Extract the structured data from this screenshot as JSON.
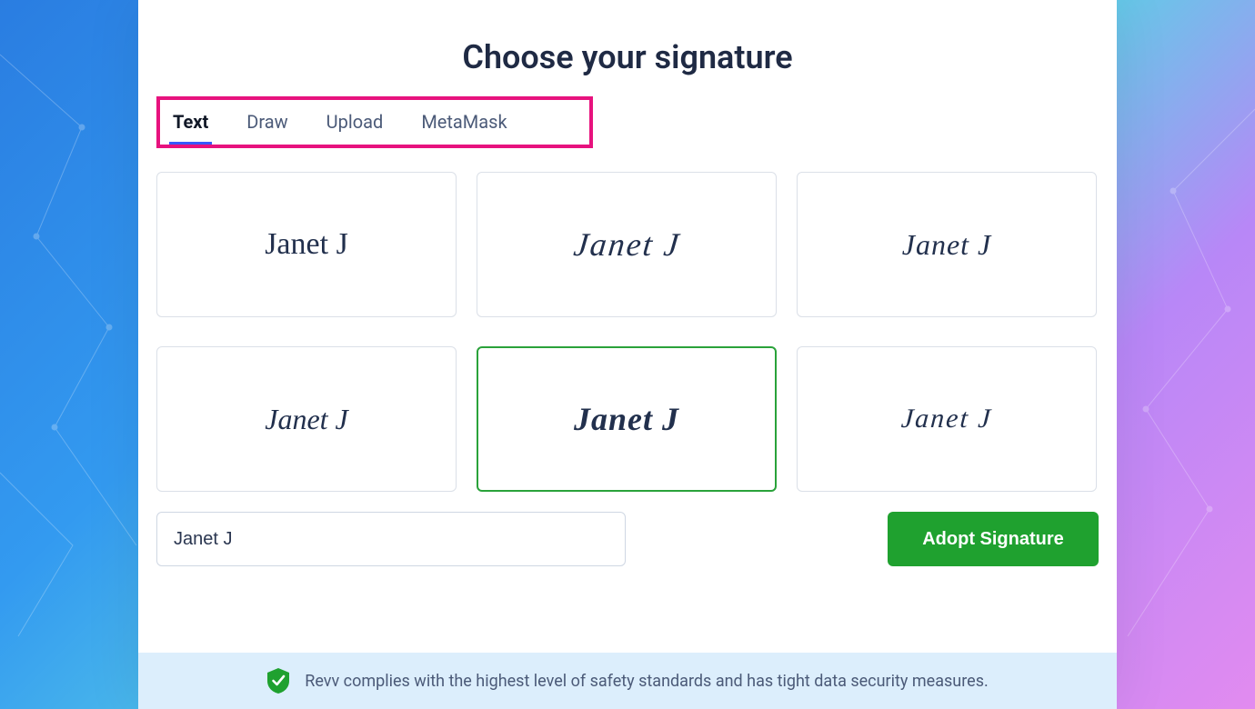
{
  "title": "Choose your signature",
  "tabs": {
    "items": [
      {
        "id": "text",
        "label": "Text",
        "active": true
      },
      {
        "id": "draw",
        "label": "Draw",
        "active": false
      },
      {
        "id": "upload",
        "label": "Upload",
        "active": false
      },
      {
        "id": "metamask",
        "label": "MetaMask",
        "active": false
      }
    ]
  },
  "signatures": [
    {
      "text": "Janet J",
      "font_class": "f1",
      "selected": false
    },
    {
      "text": "Janet J",
      "font_class": "f2",
      "selected": false
    },
    {
      "text": "Janet J",
      "font_class": "f3",
      "selected": false
    },
    {
      "text": "Janet J",
      "font_class": "f4",
      "selected": false
    },
    {
      "text": "Janet J",
      "font_class": "f5",
      "selected": true
    },
    {
      "text": "Janet J",
      "font_class": "f6",
      "selected": false
    }
  ],
  "name_input": {
    "value": "Janet J",
    "placeholder": ""
  },
  "adopt_button": {
    "label": "Adopt Signature"
  },
  "footer": {
    "text": "Revv complies with the highest level of safety standards and has tight data security measures."
  },
  "colors": {
    "highlight_box": "#e7127e",
    "tab_underline": "#3658ff",
    "selected_border": "#2aa23a",
    "primary_button": "#1fa12f",
    "footer_bg": "#dceefc"
  }
}
